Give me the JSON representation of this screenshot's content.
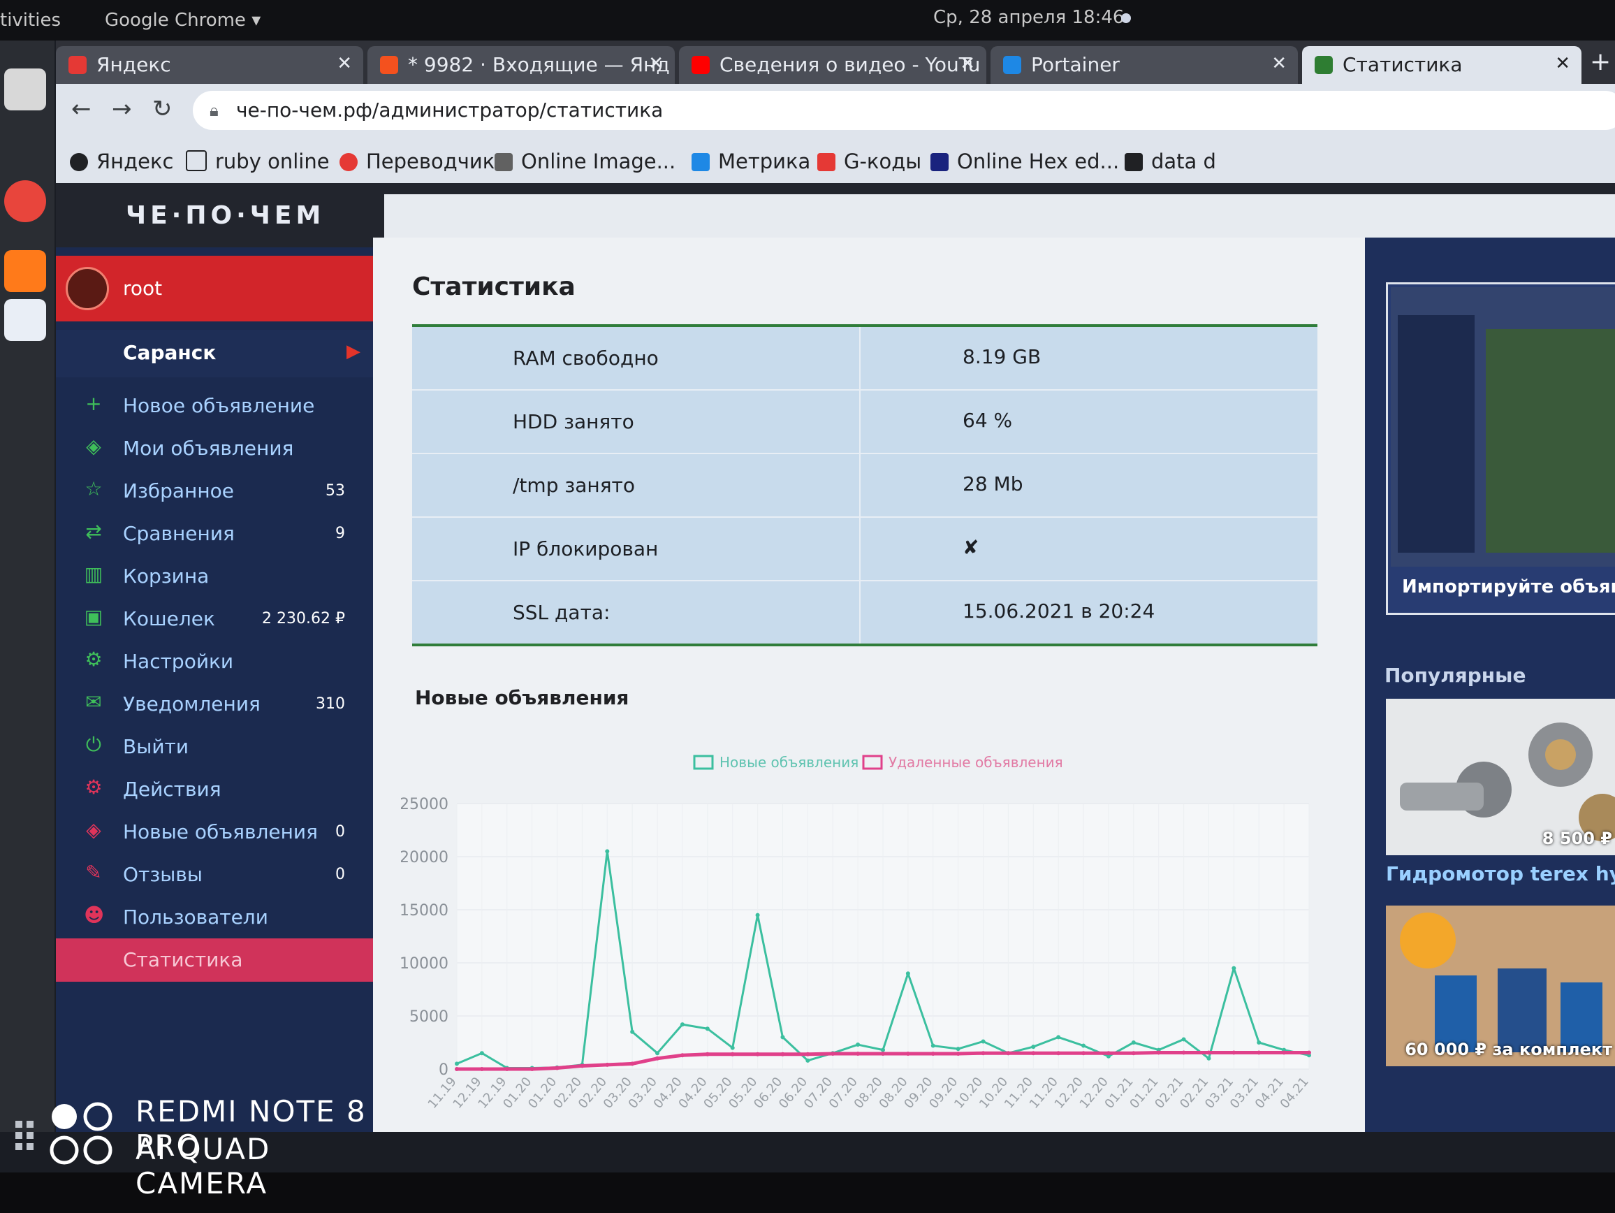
{
  "system": {
    "activities": "tivities",
    "app_name": "Google Chrome",
    "clock": "Ср, 28 апреля  18:46"
  },
  "tabs": [
    {
      "label": "Яндекс",
      "favicon_color": "#e53935",
      "active": false
    },
    {
      "label": "* 9982 · Входящие — Янд",
      "favicon_color": "#f4511e",
      "active": false
    },
    {
      "label": "Сведения о видео - YouTu",
      "favicon_color": "#ff0000",
      "active": false
    },
    {
      "label": "Portainer",
      "favicon_color": "#1e88e5",
      "active": false
    },
    {
      "label": "Статистика",
      "favicon_color": "#2e7d32",
      "active": true
    }
  ],
  "toolbar": {
    "url": "че-по-чем.рф/администратор/статистика"
  },
  "bookmarks": [
    {
      "label": "Яндекс",
      "color": "#202124"
    },
    {
      "label": "ruby online",
      "color": "#202124"
    },
    {
      "label": "Переводчик",
      "color": "#e53935"
    },
    {
      "label": "Online Image...",
      "color": "#424242"
    },
    {
      "label": "Метрика",
      "color": "#1e88e5"
    },
    {
      "label": "G-коды",
      "color": "#e53935"
    },
    {
      "label": "Online Hex ed...",
      "color": "#1a237e"
    },
    {
      "label": "data d",
      "color": "#202124"
    }
  ],
  "site": {
    "logo": "ЧЕ·ПО·ЧЕМ"
  },
  "sidebar": {
    "user": "root",
    "city": "Саранск",
    "items": [
      {
        "label": "Новое объявление",
        "icon": "plus-icon",
        "color": "#3fbf5a",
        "count": ""
      },
      {
        "label": "Мои объявления",
        "icon": "layers-icon",
        "color": "#3fbf5a",
        "count": ""
      },
      {
        "label": "Избранное",
        "icon": "star-icon",
        "color": "#3fbf5a",
        "count": "53"
      },
      {
        "label": "Сравнения",
        "icon": "compare-icon",
        "color": "#3fbf5a",
        "count": "9"
      },
      {
        "label": "Корзина",
        "icon": "trash-icon",
        "color": "#3fbf5a",
        "count": ""
      },
      {
        "label": "Кошелек",
        "icon": "wallet-icon",
        "color": "#3fbf5a",
        "count": "2 230.62 ₽"
      },
      {
        "label": "Настройки",
        "icon": "gear-icon",
        "color": "#3fbf5a",
        "count": ""
      },
      {
        "label": "Уведомления",
        "icon": "envelope-icon",
        "color": "#3fbf5a",
        "count": "310"
      },
      {
        "label": "Выйти",
        "icon": "power-icon",
        "color": "#3fbf5a",
        "count": ""
      },
      {
        "label": "Действия",
        "icon": "cog-red-icon",
        "color": "#e0345a",
        "count": ""
      },
      {
        "label": "Новые объявления",
        "icon": "layers-red-icon",
        "color": "#e0345a",
        "count": "0"
      },
      {
        "label": "Отзывы",
        "icon": "feedback-icon",
        "color": "#e0345a",
        "count": "0"
      },
      {
        "label": "Пользователи",
        "icon": "users-icon",
        "color": "#e0345a",
        "count": ""
      },
      {
        "label": "Статистика",
        "icon": "",
        "color": "#e0345a",
        "count": "",
        "active": true
      }
    ]
  },
  "main": {
    "title": "Статистика",
    "stats": [
      {
        "key": "RAM свободно",
        "value": "8.19 GB"
      },
      {
        "key": "HDD занято",
        "value": "64 %"
      },
      {
        "key": "/tmp занято",
        "value": "28 Mb"
      },
      {
        "key": "IP блокирован",
        "value": "✘"
      },
      {
        "key": "SSL дата:",
        "value": "15.06.2021 в 20:24"
      }
    ],
    "chart_title": "Новые объявления"
  },
  "chart_data": {
    "type": "line",
    "title": "",
    "xlabel": "",
    "ylabel": "",
    "ylim": [
      0,
      25000
    ],
    "yticks": [
      0,
      5000,
      10000,
      15000,
      20000,
      25000
    ],
    "grid": true,
    "legend_position": "top-center",
    "x": [
      "11.19",
      "12.19",
      "12.19",
      "01.20",
      "01.20",
      "02.20",
      "02.20",
      "03.20",
      "03.20",
      "04.20",
      "04.20",
      "05.20",
      "05.20",
      "06.20",
      "06.20",
      "07.20",
      "07.20",
      "08.20",
      "08.20",
      "09.20",
      "09.20",
      "10.20",
      "10.20",
      "11.20",
      "11.20",
      "12.20",
      "12.20",
      "01.21",
      "01.21",
      "02.21",
      "02.21",
      "03.21",
      "03.21",
      "04.21",
      "04.21"
    ],
    "series": [
      {
        "name": "Новые объявления",
        "color": "#3bbf9f",
        "values": [
          500,
          1500,
          100,
          100,
          150,
          400,
          20500,
          3500,
          1500,
          4200,
          3800,
          2000,
          14500,
          3000,
          800,
          1500,
          2300,
          1800,
          9000,
          2200,
          1900,
          2600,
          1500,
          2100,
          3000,
          2200,
          1200,
          2500,
          1800,
          2800,
          1000,
          9500,
          2500,
          1800,
          1300
        ]
      },
      {
        "name": "Удаленные объявления",
        "color": "#e0408a",
        "values": [
          0,
          0,
          0,
          0,
          100,
          300,
          400,
          500,
          1000,
          1300,
          1400,
          1400,
          1400,
          1400,
          1400,
          1450,
          1450,
          1450,
          1450,
          1450,
          1450,
          1500,
          1500,
          1500,
          1500,
          1500,
          1500,
          1500,
          1550,
          1550,
          1550,
          1550,
          1550,
          1550,
          1550
        ]
      }
    ]
  },
  "right": {
    "promo_caption": "Импортируйте объявлени",
    "popular_title": "Популярные",
    "card1_price": "8 500 ₽",
    "card1_name": "Гидромотор terex hydraulics-",
    "card2_price": "60 000 ₽ за комплект"
  },
  "watermark": {
    "line1": "REDMI NOTE 8 PRO",
    "line2": "AI QUAD CAMERA"
  }
}
